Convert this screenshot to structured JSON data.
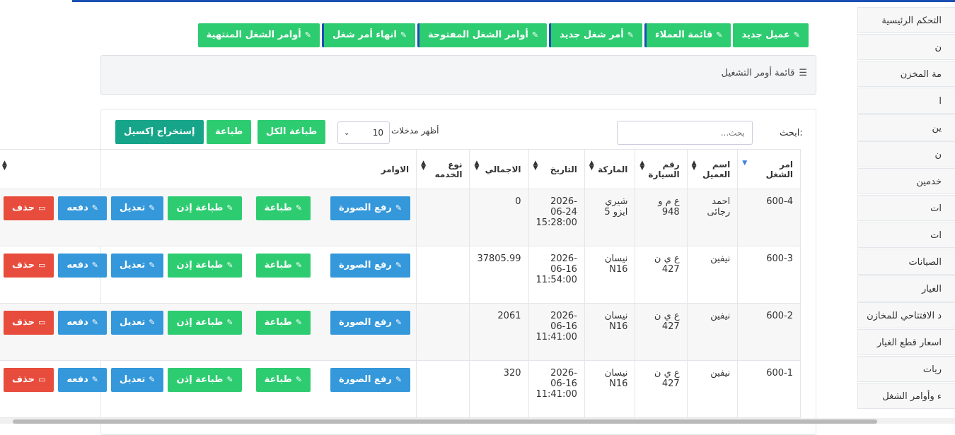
{
  "sidebar": {
    "items": [
      {
        "label": "التحكم الرئيسية"
      },
      {
        "label": "ن"
      },
      {
        "label": "مة المخزن"
      },
      {
        "label": "ا"
      },
      {
        "label": "ين"
      },
      {
        "label": "ن"
      },
      {
        "label": "خدمين"
      },
      {
        "label": "ات"
      },
      {
        "label": "ات"
      },
      {
        "label": "الصيانات"
      },
      {
        "label": "الغيار"
      },
      {
        "label": "د الافتتاحي للمخازن"
      },
      {
        "label": "اسعار قطع الغيار"
      },
      {
        "label": "ريات"
      },
      {
        "label": "ء وأوامر الشغل"
      }
    ]
  },
  "top_buttons": [
    {
      "label": "عميل جديد",
      "icon": "edit-icon"
    },
    {
      "label": "قائمة العملاء",
      "icon": "edit-icon"
    },
    {
      "label": "أمر شغل جديد",
      "icon": "edit-icon"
    },
    {
      "label": "أوامر الشغل المفتوحة",
      "icon": "edit-icon"
    },
    {
      "label": "انهاء أمر شغل",
      "icon": "edit-icon"
    },
    {
      "label": "أوامر الشغل المنتهية",
      "icon": "edit-icon"
    }
  ],
  "panel": {
    "title": "قائمة أومر التشغيل",
    "icon": "list-icon"
  },
  "controls": {
    "search_label": "ابحث:",
    "search_placeholder": "بحث...",
    "length_label": "أظهر مدخلات",
    "length_value": "10",
    "print_label": "طباعة",
    "print_all_label": "طباعة الكل",
    "excel_label": "إستخراج إكسيل"
  },
  "table": {
    "headers": [
      "امر الشغل",
      "اسم العميل",
      "رقم السيارة",
      "الماركة",
      "التاريخ",
      "الاجمالي",
      "نوع الخدمه",
      "الاوامر"
    ],
    "rows": [
      {
        "order": "600-4",
        "customer": "احمد رجائى",
        "plate": "ع م و 948",
        "brand": "شيري ايزو 5",
        "date": "2026-06-24 15:28:00",
        "total": "0",
        "service": ""
      },
      {
        "order": "600-3",
        "customer": "نيفين",
        "plate": "ع ي ن 427",
        "brand": "نيسان N16",
        "date": "2026-06-16 11:54:00",
        "total": "37805.99",
        "service": ""
      },
      {
        "order": "600-2",
        "customer": "نيفين",
        "plate": "ع ي ن 427",
        "brand": "نيسان N16",
        "date": "2026-06-16 11:41:00",
        "total": "2061",
        "service": ""
      },
      {
        "order": "600-1",
        "customer": "نيفين",
        "plate": "ع ي ن 427",
        "brand": "نيسان N16",
        "date": "2026-06-16 11:41:00",
        "total": "320",
        "service": ""
      }
    ],
    "row_actions": {
      "upload": "رفع الصورة",
      "print": "طباعة",
      "print_permit": "طباعة إذن",
      "edit": "تعديل",
      "pay": "دفعه",
      "delete": "حذف"
    }
  },
  "colors": {
    "green": "#2ecc71",
    "blue": "#3498db",
    "red": "#e74c3c",
    "teal": "#17a589",
    "topbar": "#1a4fb3"
  }
}
